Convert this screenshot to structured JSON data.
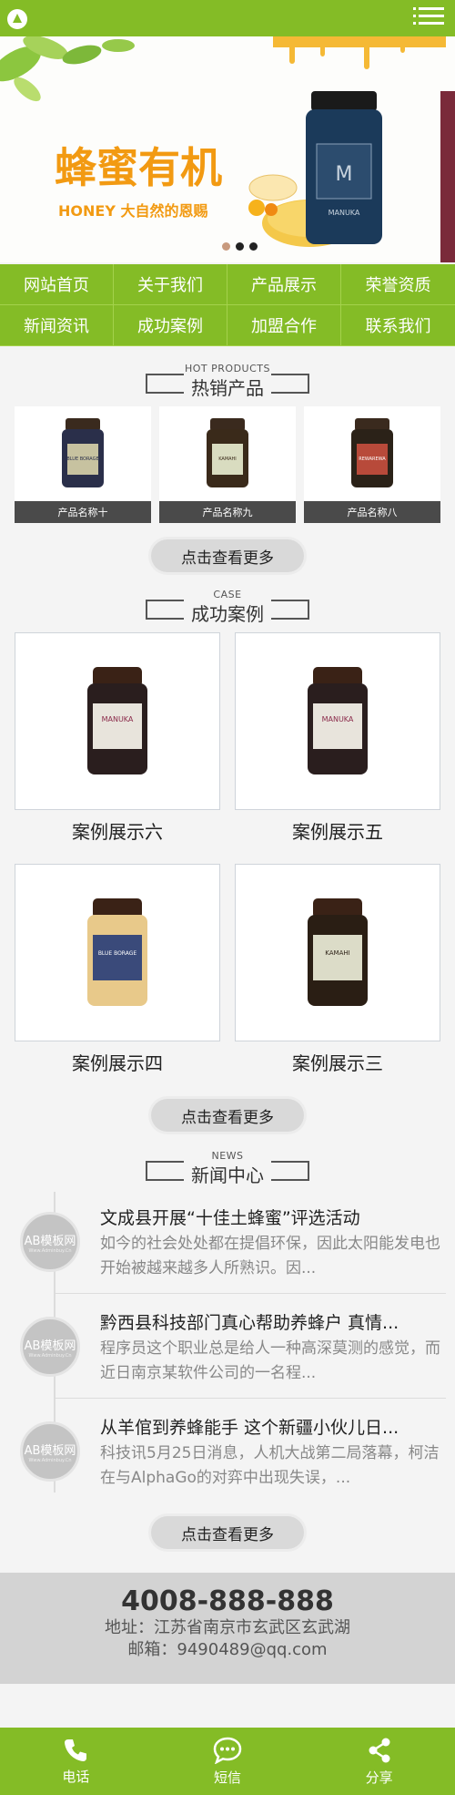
{
  "nav": {
    "items": [
      "网站首页",
      "关于我们",
      "产品展示",
      "荣誉资质",
      "新闻资讯",
      "成功案例",
      "加盟合作",
      "联系我们"
    ]
  },
  "banner": {
    "title": "蜂蜜有机",
    "subtitle": "HONEY 大自然的恩赐",
    "jar_label": "MANUKA",
    "colors": {
      "accent": "#f7a11a",
      "jar": "#1b3a5a"
    }
  },
  "hot": {
    "en": "HOT PRODUCTS",
    "cn": "热销产品",
    "products": [
      {
        "name": "产品名称十",
        "label": "BLUE BORAGE"
      },
      {
        "name": "产品名称九",
        "label": "KAMAHI"
      },
      {
        "name": "产品名称八",
        "label": "REWAREWA"
      }
    ],
    "more": "点击查看更多"
  },
  "cases": {
    "en": "CASE",
    "cn": "成功案例",
    "items": [
      {
        "name": "案例展示六",
        "label": "MANUKA"
      },
      {
        "name": "案例展示五",
        "label": "MANUKA"
      },
      {
        "name": "案例展示四",
        "label": "BLUE BORAGE"
      },
      {
        "name": "案例展示三",
        "label": "KAMAHI"
      }
    ],
    "more": "点击查看更多"
  },
  "news": {
    "en": "NEWS",
    "cn": "新闻中心",
    "badge": "AB模板网",
    "badge_sub": "Www.Adminbuy.Cn",
    "items": [
      {
        "title": "文成县开展“十佳土蜂蜜”评选活动",
        "desc": "如今的社会处处都在提倡环保，因此太阳能发电也开始被越来越多人所熟识。因..."
      },
      {
        "title": "黔西县科技部门真心帮助养蜂户 真情...",
        "desc": "程序员这个职业总是给人一种高深莫测的感觉，而近日南京某软件公司的一名程..."
      },
      {
        "title": "从羊倌到养蜂能手 这个新疆小伙儿日...",
        "desc": "科技讯5月25日消息，人机大战第二局落幕，柯洁在与AlphaGo的对弈中出现失误，..."
      }
    ],
    "more": "点击查看更多"
  },
  "footer": {
    "tel": "4008-888-888",
    "addr": "地址：江苏省南京市玄武区玄武湖",
    "mail": "邮箱：9490489@qq.com"
  },
  "bottombar": {
    "phone": "电话",
    "sms": "短信",
    "share": "分享"
  }
}
